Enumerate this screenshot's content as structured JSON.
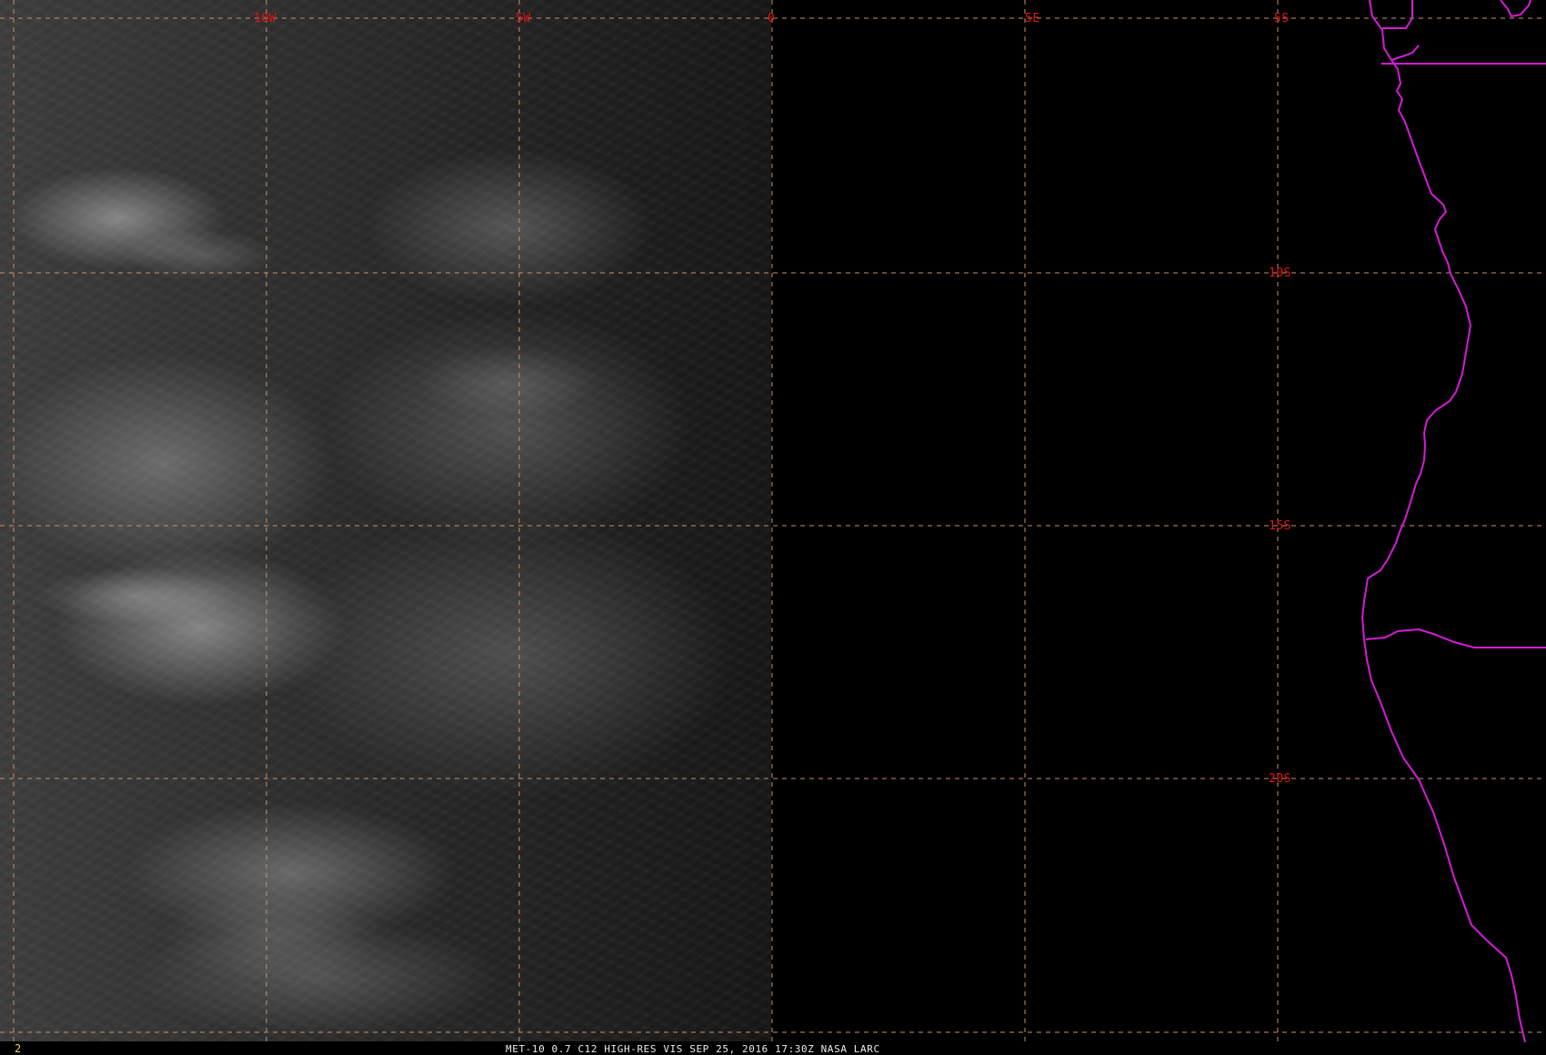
{
  "map": {
    "grid_labels": {
      "longitude": [
        "10W",
        "5W",
        "0",
        "5E"
      ],
      "latitude": [
        "5S",
        "10S",
        "15S",
        "20S"
      ]
    },
    "footer": {
      "frame_number": "2",
      "caption": "MET-10 0.7 C12 HIGH-RES VIS   SEP 25, 2016 17:30Z    NASA LARC"
    },
    "colors": {
      "background": "#000000",
      "grid": "#c8926a",
      "labels": "#e11313",
      "coast": "#d61bd6",
      "footer_text": "#ececec",
      "frame_number": "#f0d640"
    }
  }
}
